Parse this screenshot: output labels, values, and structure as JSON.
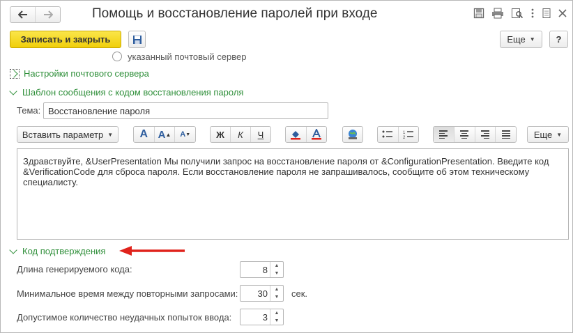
{
  "window": {
    "title": "Помощь и восстановление паролей при входе"
  },
  "toolbar": {
    "save_close": "Записать и закрыть",
    "more": "Еще",
    "help": "?"
  },
  "options": {
    "mail_server_option": "указанный почтовый сервер"
  },
  "sections": {
    "mail_settings": "Настройки почтового сервера",
    "template": "Шаблон сообщения с кодом восстановления пароля",
    "code": "Код подтверждения"
  },
  "subject": {
    "label": "Тема:",
    "value": "Восстановление пароля"
  },
  "editor": {
    "insert_param": "Вставить параметр",
    "bold": "Ж",
    "italic": "К",
    "underline": "Ч",
    "more": "Еще",
    "font_letter": "A",
    "body": "Здравствуйте, &UserPresentation  Мы получили запрос на восстановление пароля от &ConfigurationPresentation.  Введите код &VerificationCode для сброса пароля.  Если восстановление пароля не запрашивалось, сообщите об этом техническому специалисту."
  },
  "code_settings": {
    "length_label": "Длина генерируемого кода:",
    "length_value": "8",
    "interval_label": "Минимальное время между повторными запросами:",
    "interval_value": "30",
    "interval_unit": "сек.",
    "attempts_label": "Допустимое количество неудачных попыток ввода:",
    "attempts_value": "3"
  },
  "colors": {
    "accent_yellow": "#f5d80f",
    "section_green": "#2f8f3a",
    "arrow_red": "#e0231c"
  }
}
